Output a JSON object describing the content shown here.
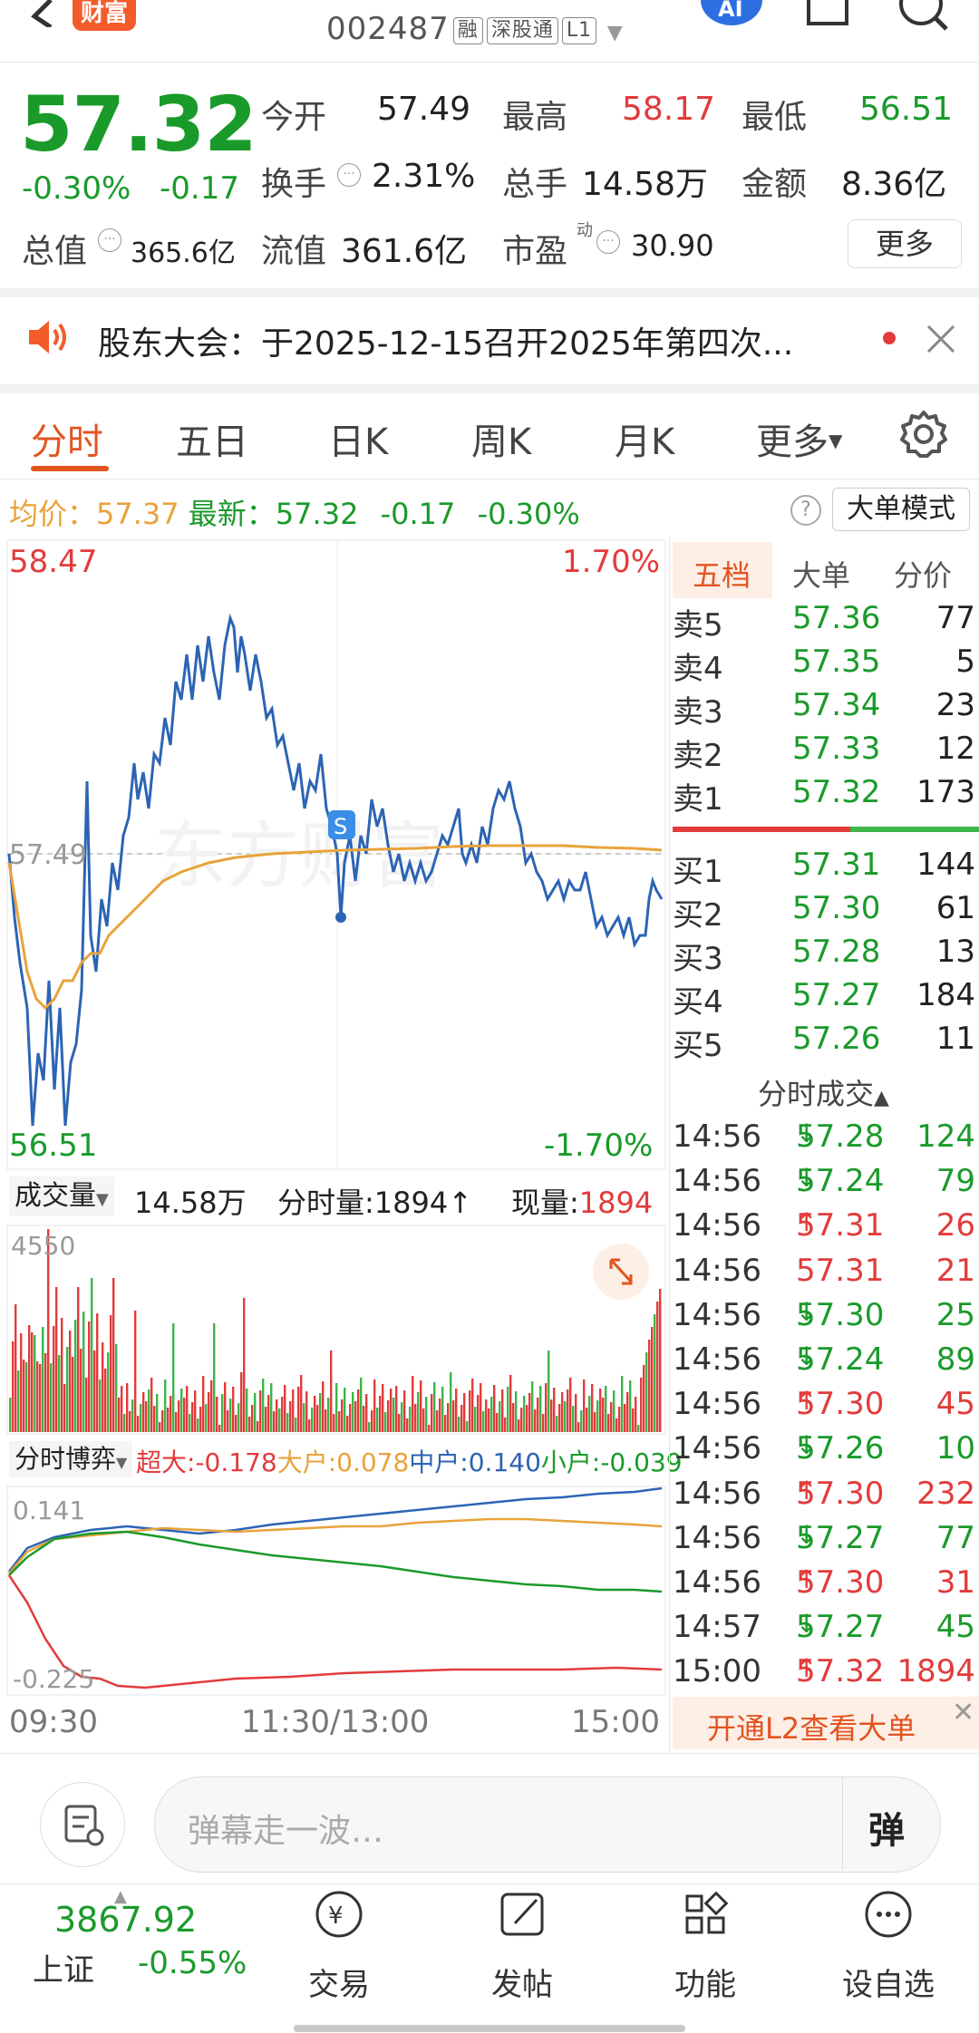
{
  "header": {
    "brand": "财富",
    "code": "002487",
    "tags": [
      "融",
      "深股通",
      "L1"
    ]
  },
  "quote": {
    "price": "57.32",
    "change_pct": "-0.30%",
    "change": "-0.17",
    "open_label": "今开",
    "open": "57.49",
    "high_label": "最高",
    "high": "58.17",
    "low_label": "最低",
    "low": "56.51",
    "turnover_label": "换手",
    "turnover": "2.31%",
    "volume_label": "总手",
    "volume": "14.58万",
    "amount_label": "金额",
    "amount": "8.36亿",
    "mktcap_label": "总值",
    "mktcap": "365.6亿",
    "float_label": "流值",
    "float_val": "361.6亿",
    "pe_label": "市盈",
    "pe_sup": "动",
    "pe": "30.90",
    "more_label": "更多"
  },
  "notice": {
    "text": "股东大会：于2025-12-15召开2025年第四次..."
  },
  "tabs": [
    "分时",
    "五日",
    "日K",
    "周K",
    "月K",
    "更多"
  ],
  "infoline": {
    "avg_label": "均价：",
    "avg": "57.37",
    "latest_label": "最新：",
    "latest": "57.32",
    "chg": "-0.17",
    "chg_pct": "-0.30%",
    "mode_button": "大单模式"
  },
  "chart_labels": {
    "top_left": "58.47",
    "top_right": "1.70%",
    "bottom_left": "56.51",
    "bottom_right": "-1.70%",
    "mid": "57.49",
    "volume_label": "成交量",
    "volume_total": "14.58万",
    "minute_vol_label": "分时量:1894",
    "current_label": "现量:",
    "current_val": "1894",
    "vol_max": "4550",
    "flow_label": "分时博弈",
    "flow_super": "超大:-0.178",
    "flow_big": "大户:0.078",
    "flow_mid": "中户:0.140",
    "flow_small": "小户:-0.039",
    "flow_top": "0.141",
    "flow_bottom": "-0.225",
    "time_start": "09:30",
    "time_mid": "11:30/13:00",
    "time_end": "15:00"
  },
  "order_book": {
    "tabs": [
      "五档",
      "大单",
      "分价"
    ],
    "asks": [
      {
        "label": "卖5",
        "price": "57.36",
        "vol": "77"
      },
      {
        "label": "卖4",
        "price": "57.35",
        "vol": "5"
      },
      {
        "label": "卖3",
        "price": "57.34",
        "vol": "23"
      },
      {
        "label": "卖2",
        "price": "57.33",
        "vol": "12"
      },
      {
        "label": "卖1",
        "price": "57.32",
        "vol": "173"
      }
    ],
    "bids": [
      {
        "label": "买1",
        "price": "57.31",
        "vol": "144"
      },
      {
        "label": "买2",
        "price": "57.30",
        "vol": "61"
      },
      {
        "label": "买3",
        "price": "57.28",
        "vol": "13"
      },
      {
        "label": "买4",
        "price": "57.27",
        "vol": "184"
      },
      {
        "label": "买5",
        "price": "57.26",
        "vol": "11"
      }
    ]
  },
  "ticks": {
    "title": "分时成交",
    "rows": [
      {
        "time": "14:56",
        "price": "57.28",
        "arrow": "↓",
        "vol": "124",
        "dir": "down"
      },
      {
        "time": "14:56",
        "price": "57.24",
        "arrow": "↓",
        "vol": "79",
        "dir": "down"
      },
      {
        "time": "14:56",
        "price": "57.31",
        "arrow": "↑",
        "vol": "26",
        "dir": "up"
      },
      {
        "time": "14:56",
        "price": "57.31",
        "arrow": "",
        "vol": "21",
        "dir": "up"
      },
      {
        "time": "14:56",
        "price": "57.30",
        "arrow": "↓",
        "vol": "25",
        "dir": "down"
      },
      {
        "time": "14:56",
        "price": "57.24",
        "arrow": "↓",
        "vol": "89",
        "dir": "down"
      },
      {
        "time": "14:56",
        "price": "57.30",
        "arrow": "↑",
        "vol": "45",
        "dir": "up"
      },
      {
        "time": "14:56",
        "price": "57.26",
        "arrow": "↓",
        "vol": "10",
        "dir": "down"
      },
      {
        "time": "14:56",
        "price": "57.30",
        "arrow": "↑",
        "vol": "232",
        "dir": "up"
      },
      {
        "time": "14:56",
        "price": "57.27",
        "arrow": "↓",
        "vol": "77",
        "dir": "down"
      },
      {
        "time": "14:56",
        "price": "57.30",
        "arrow": "↑",
        "vol": "31",
        "dir": "up"
      },
      {
        "time": "14:57",
        "price": "57.27",
        "arrow": "↓",
        "vol": "45",
        "dir": "down"
      },
      {
        "time": "15:00",
        "price": "57.32",
        "arrow": "↑",
        "vol": "1894",
        "dir": "up"
      }
    ],
    "l2_banner": "开通L2查看大单"
  },
  "comment_bar": {
    "placeholder": "弹幕走一波…",
    "danmu": "弹"
  },
  "bottom_nav": {
    "index_value": "3867.92",
    "index_name": "上证",
    "index_pct": "-0.55%",
    "items": [
      "交易",
      "发帖",
      "功能",
      "设自选"
    ]
  },
  "colors": {
    "up": "#e23b3b",
    "down": "#1a9a2a",
    "accent": "#e2541f",
    "price_line": "#2c64b4",
    "avg_line": "#e8a33b"
  }
}
